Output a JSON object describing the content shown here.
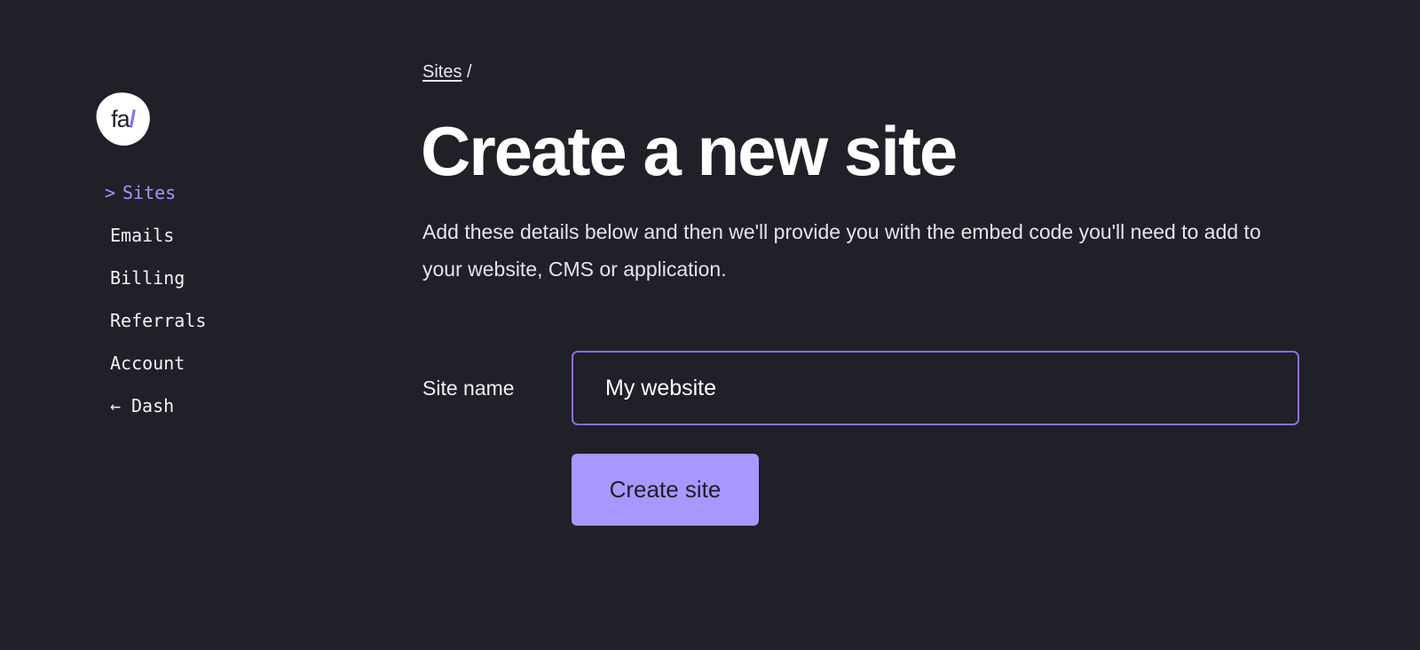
{
  "app": {
    "logo_text": "fa",
    "logo_slash": "/",
    "accent_color": "#8b6cf7",
    "button_color": "#a798ff",
    "background_color": "#202029"
  },
  "sidebar": {
    "items": [
      {
        "label": "Sites",
        "prefix": ">",
        "active": true
      },
      {
        "label": "Emails",
        "prefix": "",
        "active": false
      },
      {
        "label": "Billing",
        "prefix": "",
        "active": false
      },
      {
        "label": "Referrals",
        "prefix": "",
        "active": false
      },
      {
        "label": "Account",
        "prefix": "",
        "active": false
      },
      {
        "label": "Dash",
        "prefix": "←",
        "active": false
      }
    ]
  },
  "breadcrumb": {
    "link": "Sites",
    "separator": "/"
  },
  "main": {
    "title": "Create a new site",
    "description": "Add these details below and then we'll provide you with the embed code you'll need to add to your website, CMS or application."
  },
  "form": {
    "site_name_label": "Site name",
    "site_name_value": "My website",
    "submit_label": "Create site"
  }
}
